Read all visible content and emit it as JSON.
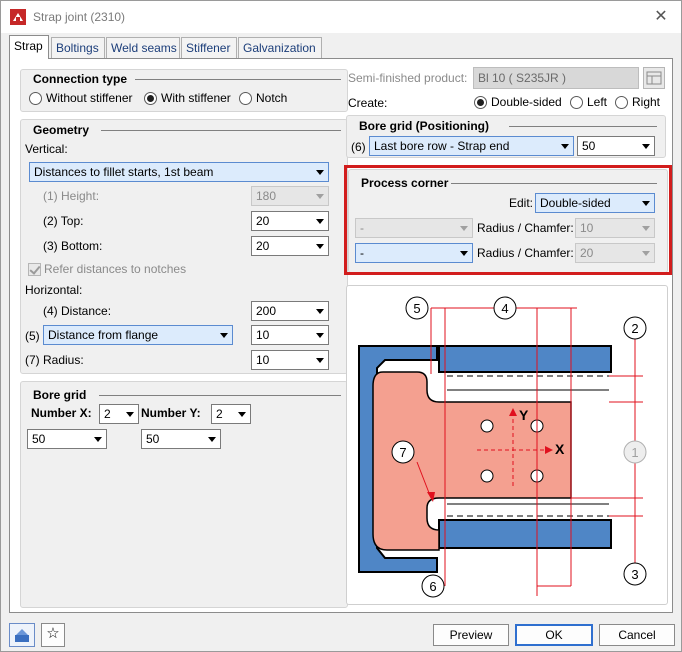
{
  "window": {
    "title": "Strap joint (2310)"
  },
  "tabs": [
    "Strap",
    "Boltings",
    "Weld seams",
    "Stiffener",
    "Galvanization"
  ],
  "connection_type": {
    "title": "Connection type",
    "options": [
      "Without stiffener",
      "With stiffener",
      "Notch"
    ],
    "selected": "With stiffener"
  },
  "geometry": {
    "title": "Geometry",
    "vertical_label": "Vertical:",
    "vertical_value": "Distances to fillet starts, 1st beam",
    "height_label": "(1) Height:",
    "height_value": "180",
    "top_label": "(2) Top:",
    "top_value": "20",
    "bottom_label": "(3) Bottom:",
    "bottom_value": "20",
    "refer_label": "Refer distances to notches",
    "horizontal_label": "Horizontal:",
    "distance_label": "(4) Distance:",
    "distance_value": "200",
    "five_prefix": "(5)",
    "five_select": "Distance from flange",
    "five_value": "10",
    "radius_label": "(7) Radius:",
    "radius_value": "10"
  },
  "bore_grid": {
    "title": "Bore grid",
    "number_x_label": "Number X:",
    "number_x_value": "2",
    "number_y_label": "Number Y:",
    "number_y_value": "2",
    "x_spacing": "50",
    "y_spacing": "50"
  },
  "semi_finished": {
    "label": "Semi-finished product:",
    "value": "Bl 10  ( S235JR )",
    "create_label": "Create:",
    "create_options": [
      "Double-sided",
      "Left",
      "Right"
    ],
    "create_selected": "Double-sided"
  },
  "bore_positioning": {
    "title": "Bore grid (Positioning)",
    "prefix": "(6)",
    "select": "Last bore row - Strap end",
    "value": "50"
  },
  "process_corner": {
    "title": "Process corner",
    "edit_label": "Edit:",
    "edit_value": "Double-sided",
    "row1_select": "-",
    "row1_label": "Radius / Chamfer:",
    "row1_value": "10",
    "row2_select": "-",
    "row2_label": "Radius / Chamfer:",
    "row2_value": "20"
  },
  "diagram": {
    "markers": [
      "5",
      "4",
      "2",
      "1",
      "7",
      "3",
      "6"
    ],
    "axis_x": "X",
    "axis_y": "Y"
  },
  "footer": {
    "preview": "Preview",
    "ok": "OK",
    "cancel": "Cancel"
  },
  "colors": {
    "blue_profile": "#4f86c6",
    "strap": "#f4a090",
    "highlight": "#d21d1d",
    "dimension": "#e0101e"
  }
}
